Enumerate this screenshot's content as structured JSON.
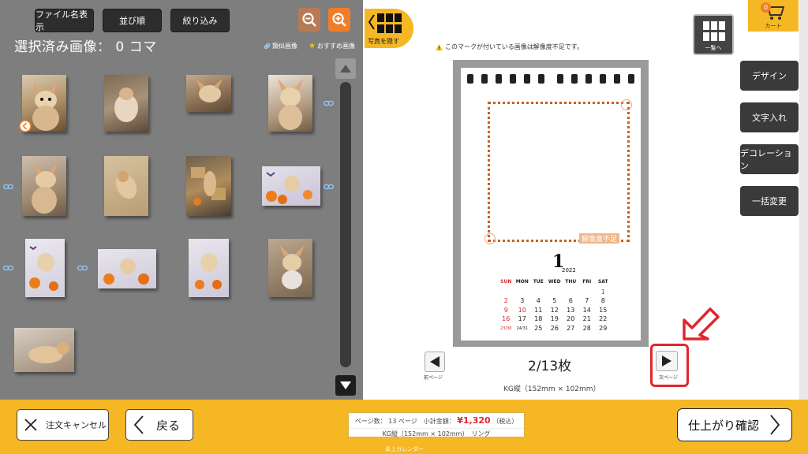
{
  "left_panel": {
    "filename_label": "ファイル名表示",
    "sort_label": "並び順",
    "filter_label": "絞り込み",
    "selected_count": "選択済み画像： 0 コマ",
    "legend_similar": "類似画像",
    "legend_recommend": "おすすめ画像"
  },
  "right_panel": {
    "hide_photos_label": "写真を隠す",
    "warning": "このマークが付いている画像は解像度不足です。",
    "list_label": "一覧へ",
    "cart_label": "カート",
    "cart_count": "0",
    "side_buttons": {
      "design": "デザイン",
      "text": "文字入れ",
      "decoration": "デコレーション",
      "bulk": "一括変更"
    },
    "calendar": {
      "resolution_note": "解像度不足",
      "month": "1",
      "year": "2022",
      "weekdays": [
        "SUN",
        "MON",
        "TUE",
        "WED",
        "THU",
        "FRI",
        "SAT"
      ],
      "week1": [
        "",
        "",
        "",
        "",
        "",
        "",
        "1"
      ],
      "week2": [
        "2",
        "3",
        "4",
        "5",
        "6",
        "7",
        "8"
      ],
      "week3": [
        "9",
        "10",
        "11",
        "12",
        "13",
        "14",
        "15"
      ],
      "week4": [
        "16",
        "17",
        "18",
        "19",
        "20",
        "21",
        "22"
      ],
      "week5": [
        "23/30",
        "24/31",
        "25",
        "26",
        "27",
        "28",
        "29"
      ]
    },
    "prev_label": "前ページ",
    "next_label": "次ページ",
    "page_indicator": "2/13枚",
    "size_label": "KG縦（152mm × 102mm）"
  },
  "bottom_bar": {
    "cancel_label": "注文キャンセル",
    "back_label": "戻る",
    "summary_pages": "ページ数： 13 ページ　小計金額：",
    "summary_price": "¥1,320",
    "summary_tax": "（税込）",
    "summary_size": "KG縦（152mm × 102mm）　リング",
    "product_type": "卓上カレンダー",
    "confirm_label": "仕上がり確認"
  },
  "colors": {
    "accent": "#f5b724",
    "panel": "#7e7e7e",
    "highlight": "#e0262d",
    "zoom": "#f07e28"
  }
}
